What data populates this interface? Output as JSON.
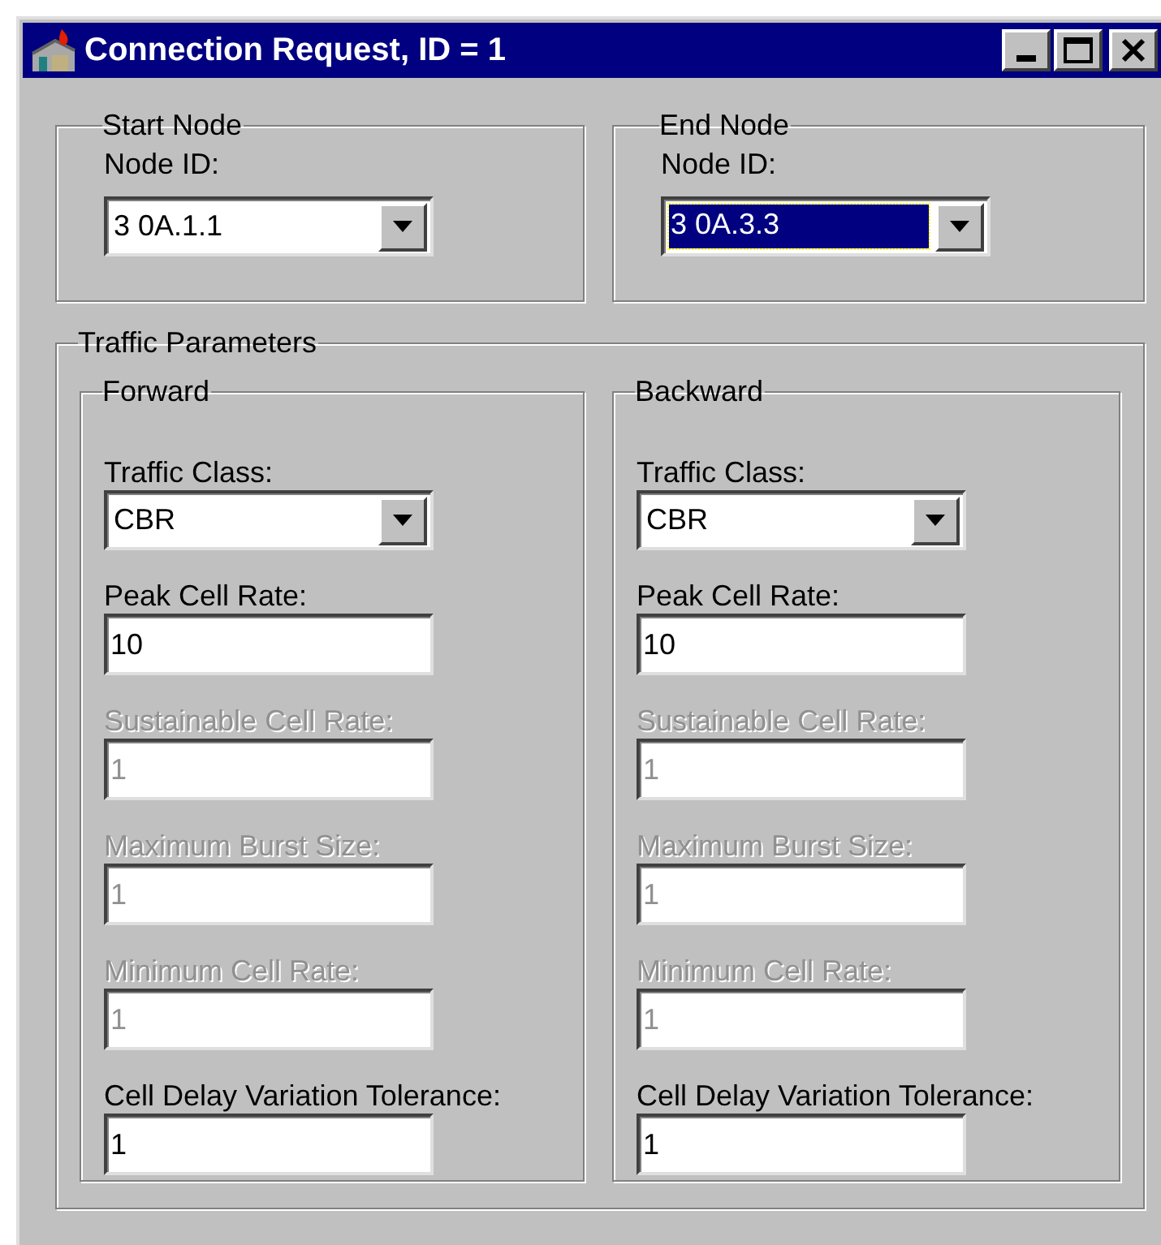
{
  "window": {
    "title": "Connection Request, ID = 1"
  },
  "start_node": {
    "title": "Start Node",
    "label": "Node ID:",
    "value": "3 0A.1.1",
    "selected": false
  },
  "end_node": {
    "title": "End Node",
    "label": "Node ID:",
    "value": "3 0A.3.3",
    "selected": true
  },
  "traffic_parameters": {
    "title": "Traffic Parameters",
    "directions": [
      {
        "title": "Forward",
        "fields": [
          {
            "kind": "combo",
            "label": "Traffic Class:",
            "value": "CBR",
            "disabled": false
          },
          {
            "kind": "text",
            "label": "Peak Cell Rate:",
            "value": "10",
            "disabled": false
          },
          {
            "kind": "text",
            "label": "Sustainable Cell Rate:",
            "value": "1",
            "disabled": true
          },
          {
            "kind": "text",
            "label": "Maximum Burst Size:",
            "value": "1",
            "disabled": true
          },
          {
            "kind": "text",
            "label": "Minimum Cell Rate:",
            "value": "1",
            "disabled": true
          },
          {
            "kind": "text",
            "label": "Cell Delay Variation Tolerance:",
            "value": "1",
            "disabled": false
          }
        ]
      },
      {
        "title": "Backward",
        "fields": [
          {
            "kind": "combo",
            "label": "Traffic Class:",
            "value": "CBR",
            "disabled": false
          },
          {
            "kind": "text",
            "label": "Peak Cell Rate:",
            "value": "10",
            "disabled": false
          },
          {
            "kind": "text",
            "label": "Sustainable Cell Rate:",
            "value": "1",
            "disabled": true
          },
          {
            "kind": "text",
            "label": "Maximum Burst Size:",
            "value": "1",
            "disabled": true
          },
          {
            "kind": "text",
            "label": "Minimum Cell Rate:",
            "value": "1",
            "disabled": true
          },
          {
            "kind": "text",
            "label": "Cell Delay Variation Tolerance:",
            "value": "1",
            "disabled": false
          }
        ]
      }
    ]
  }
}
